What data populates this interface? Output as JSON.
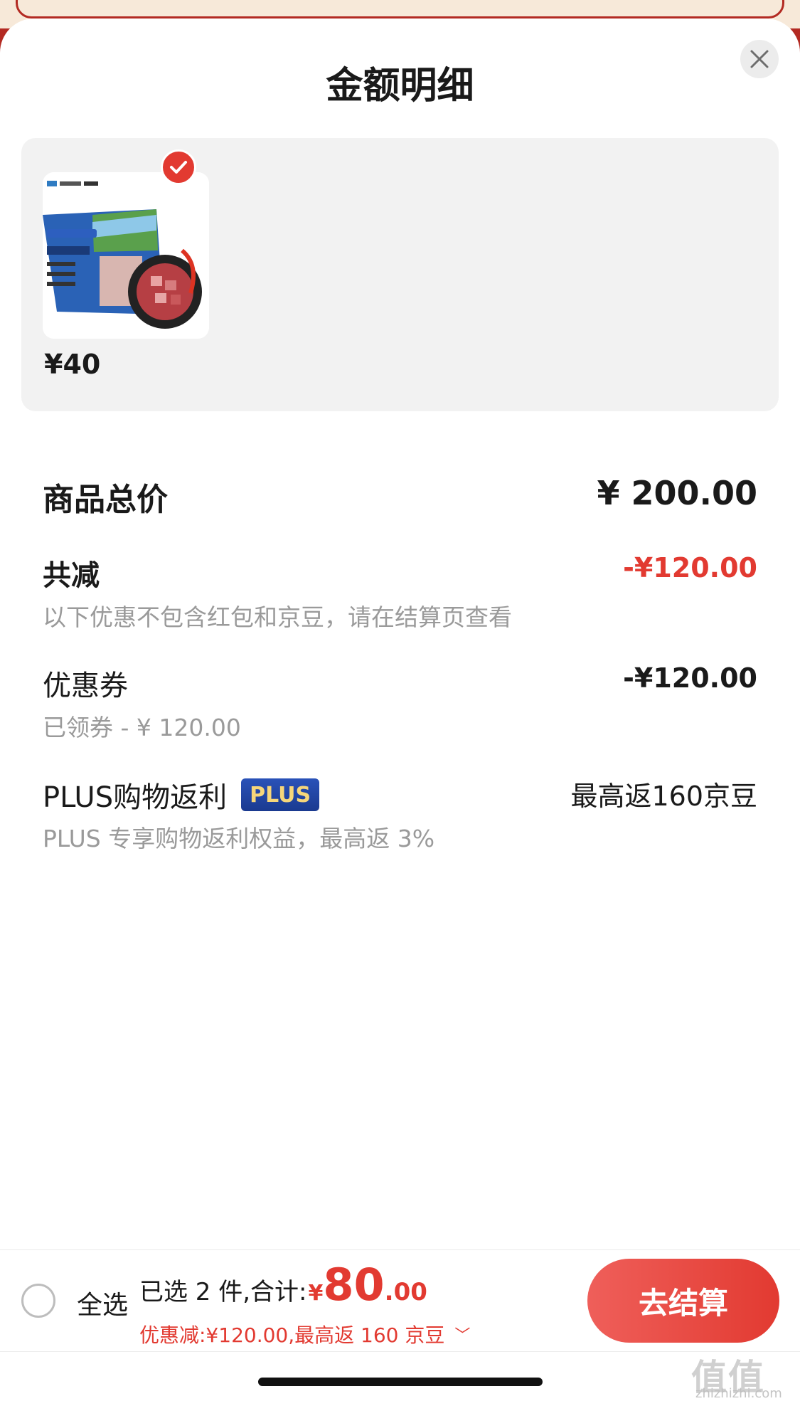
{
  "sheet": {
    "title": "金额明细"
  },
  "product": {
    "price": "¥40",
    "selected": true
  },
  "summary_rows": {
    "total": {
      "label": "商品总价",
      "value": "¥ 200.00"
    },
    "reduction": {
      "label": "共减",
      "value": "-¥120.00",
      "note": "以下优惠不包含红包和京豆，请在结算页查看"
    },
    "coupon": {
      "label": "优惠券",
      "value": "-¥120.00",
      "note": "已领券 - ¥ 120.00"
    },
    "plus": {
      "label": "PLUS购物返利",
      "badge": "PLUS",
      "value": "最高返160京豆",
      "note": "PLUS 专享购物返利权益，最高返 3%"
    }
  },
  "bottom_bar": {
    "select_all_label": "全选",
    "selected_text": "已选 2 件,合计:",
    "currency": "¥",
    "amount_int": "80",
    "amount_dec": ".00",
    "discount_text": "优惠减:¥120.00,最高返 160 京豆",
    "checkout_label": "去结算"
  },
  "watermark": {
    "text": "值值值",
    "url": "zhizhizhi.com"
  },
  "colors": {
    "accent": "#e23a31",
    "plus_badge_bg": "#1a3a90",
    "plus_badge_text": "#f6d67a"
  }
}
